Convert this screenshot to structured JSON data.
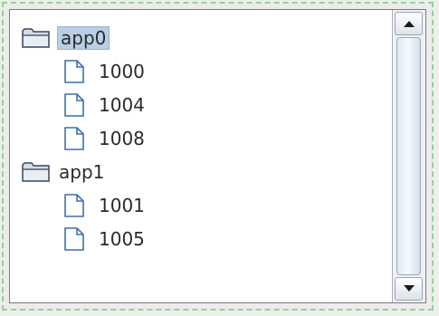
{
  "tree": {
    "items": [
      {
        "type": "folder",
        "label": "app0",
        "selected": true,
        "icon": "folder-icon"
      },
      {
        "type": "leaf",
        "label": "1000",
        "icon": "file-icon"
      },
      {
        "type": "leaf",
        "label": "1004",
        "icon": "file-icon"
      },
      {
        "type": "leaf",
        "label": "1008",
        "icon": "file-icon"
      },
      {
        "type": "folder",
        "label": "app1",
        "selected": false,
        "icon": "folder-icon"
      },
      {
        "type": "leaf",
        "label": "1001",
        "icon": "file-icon"
      },
      {
        "type": "leaf",
        "label": "1005",
        "icon": "file-icon"
      }
    ]
  },
  "scrollbar": {
    "up_icon": "arrow-up-icon",
    "down_icon": "arrow-down-icon"
  },
  "colors": {
    "selection": "#b8cfe5",
    "frame_dash": "#8fd68f"
  }
}
